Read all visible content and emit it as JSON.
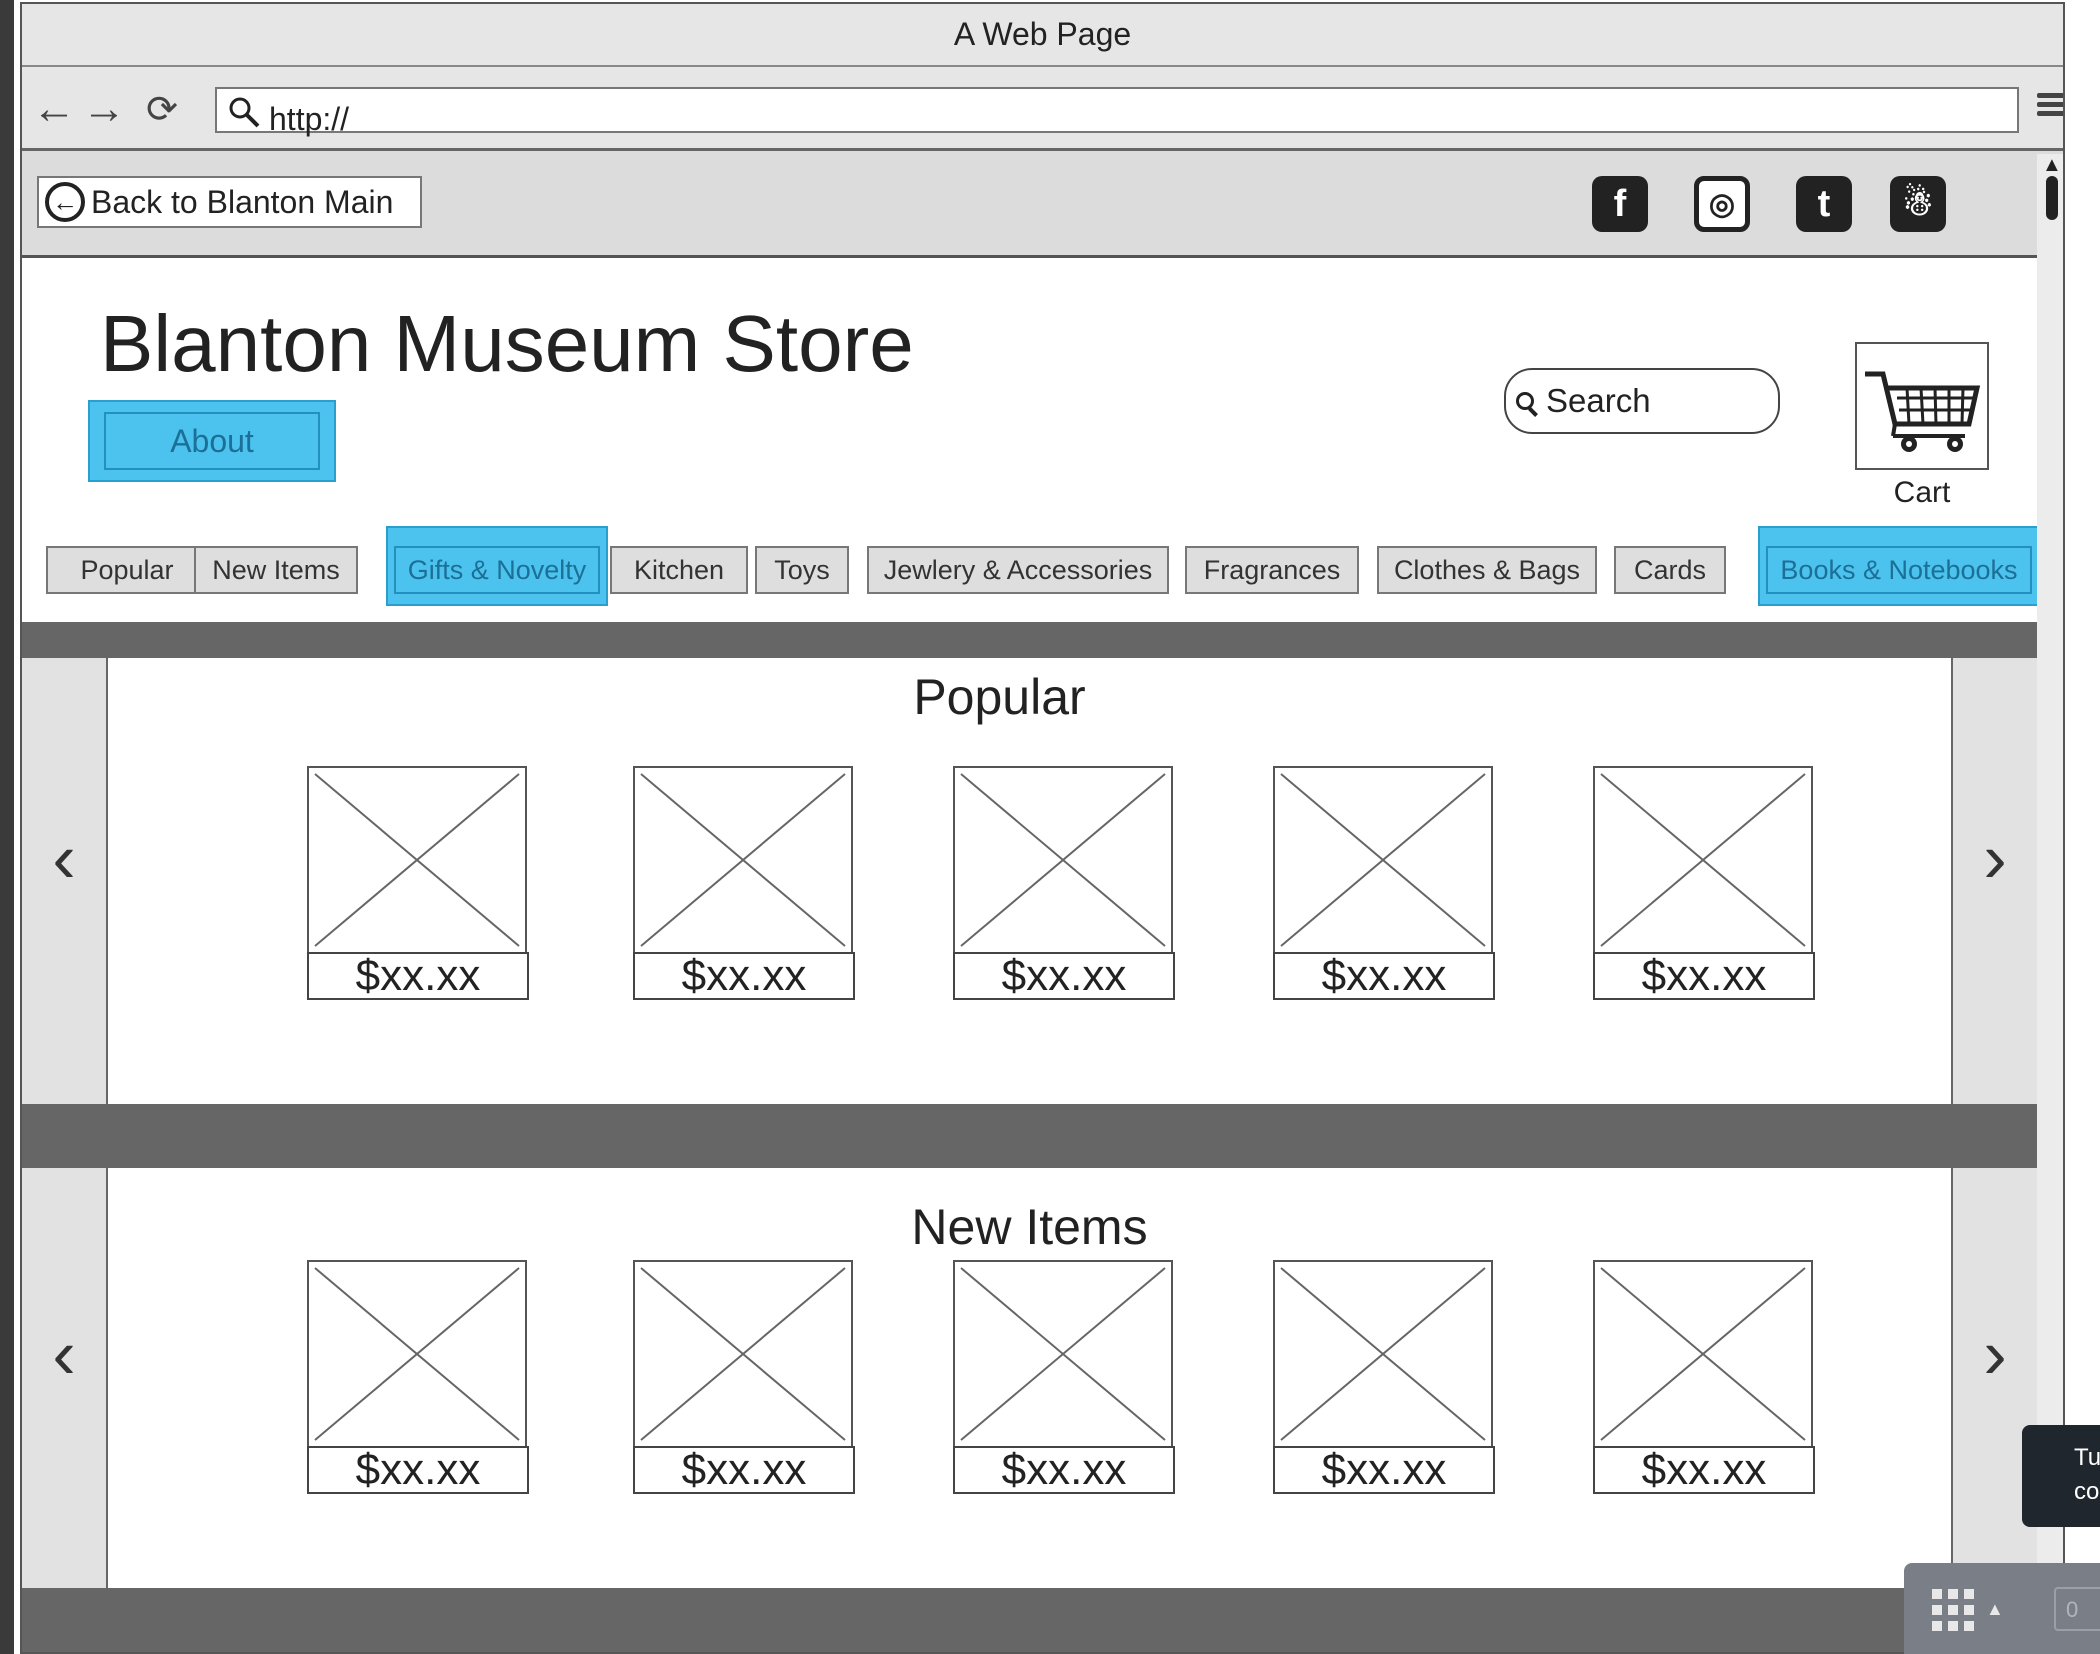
{
  "browser": {
    "title": "A Web Page",
    "url": "http://"
  },
  "topbar": {
    "back_label": "Back to Blanton Main",
    "social": [
      {
        "name": "facebook",
        "glyph": "f"
      },
      {
        "name": "instagram",
        "glyph": "◎"
      },
      {
        "name": "twitter",
        "glyph": "t"
      },
      {
        "name": "snapchat",
        "glyph": "☃"
      }
    ]
  },
  "header": {
    "store_title": "Blanton Museum Store",
    "about_label": "About",
    "search_placeholder": "Search",
    "cart_label": "Cart"
  },
  "categories": [
    {
      "label": "Popular",
      "highlighted": false
    },
    {
      "label": "New Items",
      "highlighted": false
    },
    {
      "label": "Gifts & Novelty",
      "highlighted": true
    },
    {
      "label": "Kitchen",
      "highlighted": false
    },
    {
      "label": "Toys",
      "highlighted": false
    },
    {
      "label": "Jewlery & Accessories",
      "highlighted": false
    },
    {
      "label": "Fragrances",
      "highlighted": false
    },
    {
      "label": "Clothes & Bags",
      "highlighted": false
    },
    {
      "label": "Cards",
      "highlighted": false
    },
    {
      "label": "Books & Notebooks",
      "highlighted": true
    }
  ],
  "sections": [
    {
      "title": "Popular",
      "prev_glyph": "‹",
      "next_glyph": "›",
      "products": [
        {
          "price": "$xx.xx"
        },
        {
          "price": "$xx.xx"
        },
        {
          "price": "$xx.xx"
        },
        {
          "price": "$xx.xx"
        },
        {
          "price": "$xx.xx"
        }
      ]
    },
    {
      "title": "New Items",
      "prev_glyph": "‹",
      "next_glyph": "›",
      "products": [
        {
          "price": "$xx.xx"
        },
        {
          "price": "$xx.xx"
        },
        {
          "price": "$xx.xx"
        },
        {
          "price": "$xx.xx"
        },
        {
          "price": "$xx.xx"
        }
      ]
    }
  ],
  "overlay": {
    "tooltip_line1": "Tu",
    "tooltip_line2": "co",
    "widget_field": "0"
  },
  "colors": {
    "highlight": "#4cc3ee",
    "divider": "#666666"
  }
}
